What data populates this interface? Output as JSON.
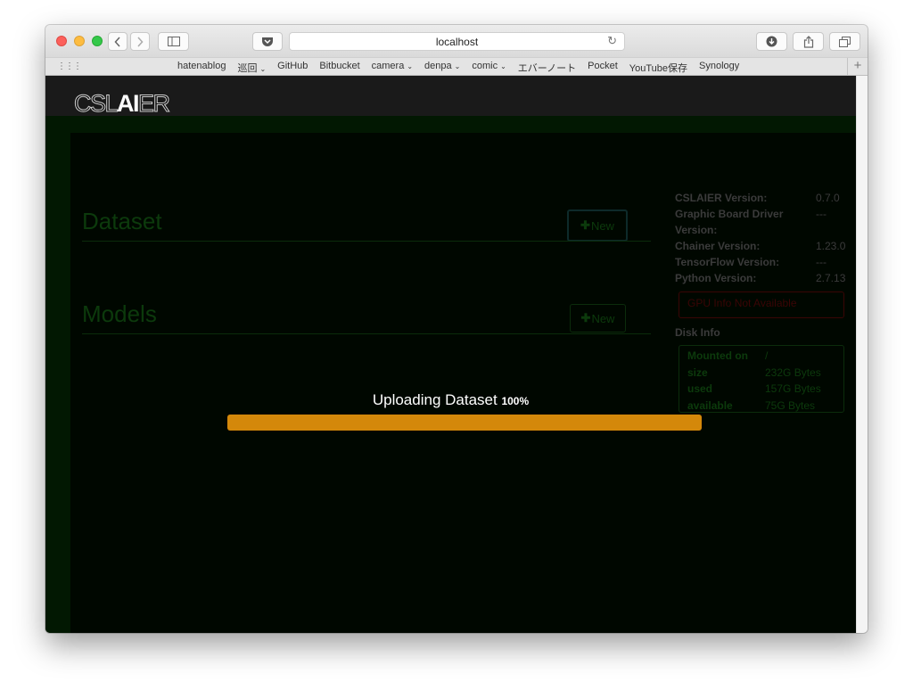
{
  "browser": {
    "url": "localhost",
    "bookmarks": [
      {
        "label": "hatenablog",
        "menu": false
      },
      {
        "label": "巡回",
        "menu": true
      },
      {
        "label": "GitHub",
        "menu": false
      },
      {
        "label": "Bitbucket",
        "menu": false
      },
      {
        "label": "camera",
        "menu": true
      },
      {
        "label": "denpa",
        "menu": true
      },
      {
        "label": "comic",
        "menu": true
      },
      {
        "label": "エバーノート",
        "menu": false
      },
      {
        "label": "Pocket",
        "menu": false
      },
      {
        "label": "YouTube保存",
        "menu": false
      },
      {
        "label": "Synology",
        "menu": false
      }
    ]
  },
  "app": {
    "logo_left": "CSL",
    "logo_bold": "AI",
    "logo_right": "ER"
  },
  "sections": {
    "dataset_title": "Dataset",
    "models_title": "Models",
    "new_label": "New"
  },
  "info": {
    "rows": [
      {
        "label": "CSLAIER Version:",
        "value": "0.7.0"
      },
      {
        "label": "Graphic Board Driver Version:",
        "value": "---"
      },
      {
        "label": "Chainer Version:",
        "value": "1.23.0"
      },
      {
        "label": "TensorFlow Version:",
        "value": "---"
      },
      {
        "label": "Python Version:",
        "value": "2.7.13"
      }
    ],
    "gpu_message": "GPU Info Not Available"
  },
  "disk": {
    "title": "Disk Info",
    "rows": [
      {
        "key": "Mounted on",
        "value": "/"
      },
      {
        "key": "size",
        "value": "232G Bytes"
      },
      {
        "key": "used",
        "value": "157G Bytes"
      },
      {
        "key": "available",
        "value": "75G Bytes"
      }
    ]
  },
  "upload": {
    "label": "Uploading Dataset",
    "percent_text": "100%",
    "progress": 1.0
  },
  "colors": {
    "progress_fill": "#d4880a",
    "content_bg": "#000700"
  }
}
